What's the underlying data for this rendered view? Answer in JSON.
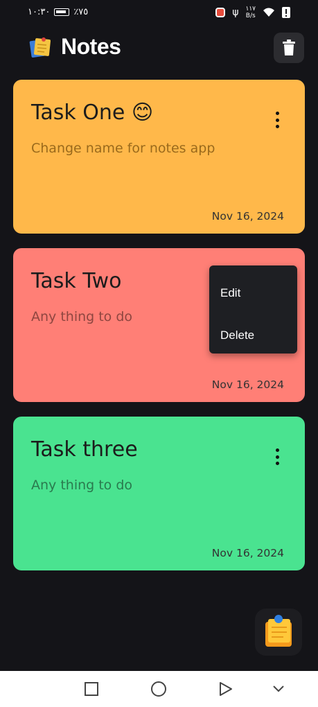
{
  "status_bar": {
    "time": "١٠:٣٠",
    "battery_percent": "٪٧٥",
    "net_speed_value": "١١٧",
    "net_speed_unit": "B/s"
  },
  "app": {
    "title": "Notes",
    "logo_icon": "sticky-notes-icon",
    "trash_icon": "trash-icon"
  },
  "notes": [
    {
      "title": "Task One 😊",
      "body": "Change name for notes app",
      "date": "Nov 16, 2024",
      "color": "#FFB84A",
      "body_color": "#9A6A1C"
    },
    {
      "title": "Task Two",
      "body": "Any thing to do",
      "date": "Nov 16, 2024",
      "color": "#FF7F76",
      "body_color": "#8E4640"
    },
    {
      "title": "Task three",
      "body": "Any thing to do",
      "date": "Nov 16, 2024",
      "color": "#4AE390",
      "body_color": "#2A7A4E"
    }
  ],
  "context_menu": {
    "edit_label": "Edit",
    "delete_label": "Delete"
  },
  "fab": {
    "icon": "add-note-icon"
  },
  "nav_bar": {
    "items": [
      "recent-apps-icon",
      "home-icon",
      "back-icon",
      "collapse-icon"
    ]
  }
}
